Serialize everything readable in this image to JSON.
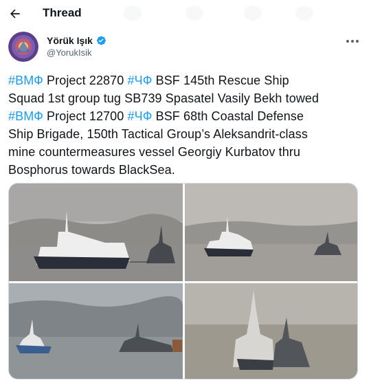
{
  "header": {
    "title": "Thread",
    "back_icon": "arrow-left-icon"
  },
  "tweet": {
    "author_name": "Yörük Işık",
    "handle": "@YorukIsik",
    "verified": true,
    "more_icon": "more-horizontal-icon",
    "text_lines": [
      [
        {
          "t": "#ВМФ",
          "tag": true
        },
        {
          "t": " Project 22870 "
        },
        {
          "t": "#ЧФ",
          "tag": true
        },
        {
          "t": " BSF 145th Rescue Ship"
        }
      ],
      [
        {
          "t": "Squad 1st group tug SB739 Spasatel Vasily Bekh towed"
        }
      ],
      [
        {
          "t": "#ВМФ",
          "tag": true
        },
        {
          "t": " Project 12700 "
        },
        {
          "t": "#ЧФ",
          "tag": true
        },
        {
          "t": " BSF 68th Coastal Defense"
        }
      ],
      [
        {
          "t": "Ship Brigade, 150th Tactical Group’s Aleksandrit-class"
        }
      ],
      [
        {
          "t": "mine countermeasures vessel Georgiy Kurbatov thru"
        }
      ],
      [
        {
          "t": "Bosphorus towards BlackSea."
        }
      ]
    ]
  },
  "colors": {
    "link": "#1d9bf0",
    "text": "#0f1419",
    "secondary": "#536471",
    "border": "#cfd9de"
  }
}
